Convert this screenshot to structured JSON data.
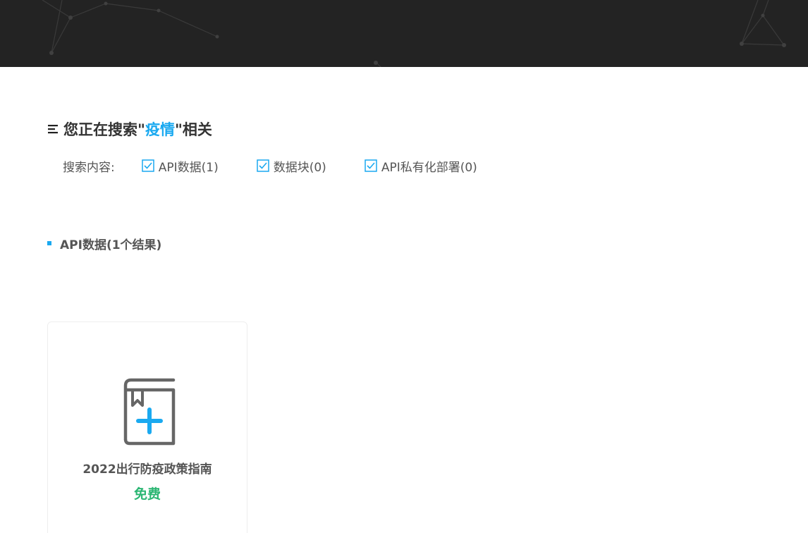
{
  "header": {
    "background": "#232323"
  },
  "search": {
    "title_prefix": "您正在搜索\"",
    "keyword": "疫情",
    "title_suffix": "\"相关",
    "keyword_color": "#1aa9f0"
  },
  "filters": {
    "label": "搜索内容:",
    "options": [
      {
        "label": "API数据(1)",
        "checked": true
      },
      {
        "label": "数据块(0)",
        "checked": true
      },
      {
        "label": "API私有化部署(0)",
        "checked": true
      }
    ]
  },
  "section": {
    "title": "API数据(1个结果)"
  },
  "cards": [
    {
      "icon": "book-plus-icon",
      "title": "2022出行防疫政策指南",
      "price": "免费",
      "price_color": "#2bb673"
    }
  ]
}
